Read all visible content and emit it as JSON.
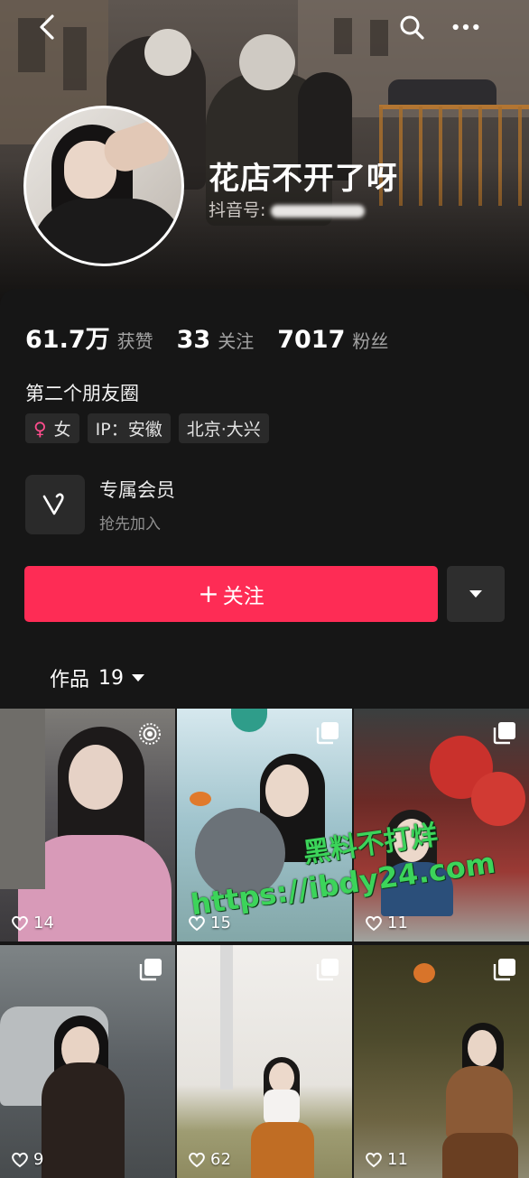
{
  "profile": {
    "nickname": "花店不开了呀",
    "douyin_id_label": "抖音号:",
    "bio": "第二个朋友圈"
  },
  "stats": [
    {
      "value": "61.7万",
      "label": "获赞"
    },
    {
      "value": "33",
      "label": "关注"
    },
    {
      "value": "7017",
      "label": "粉丝"
    }
  ],
  "tags": {
    "gender_symbol": "♀",
    "gender": "女",
    "ip": "IP：安徽",
    "location": "北京·大兴"
  },
  "vip": {
    "title": "专属会员",
    "subtitle": "抢先加入"
  },
  "actions": {
    "follow_plus": "+",
    "follow_label": "关注"
  },
  "works": {
    "tab_label": "作品",
    "count": "19"
  },
  "videos": [
    {
      "likes": "14",
      "badge": "live-icon"
    },
    {
      "likes": "15",
      "badge": "gallery-icon"
    },
    {
      "likes": "11",
      "badge": "gallery-icon"
    },
    {
      "likes": "9",
      "badge": "gallery-icon"
    },
    {
      "likes": "62",
      "badge": "gallery-icon"
    },
    {
      "likes": "11",
      "badge": "gallery-icon"
    }
  ],
  "watermark": {
    "line1": "黑料不打烊",
    "line2": "https://ibdy24.com"
  },
  "colors": {
    "accent": "#fe2c55",
    "background": "#161616",
    "tag_bg": "#2a2a2a",
    "watermark": "#3cd45a"
  }
}
